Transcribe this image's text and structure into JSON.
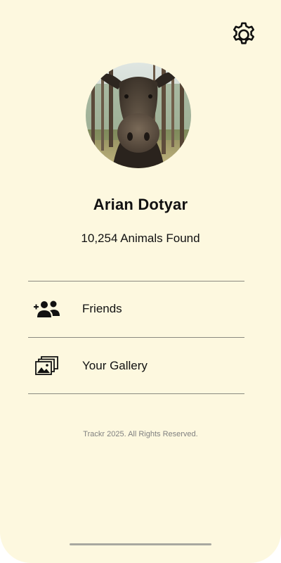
{
  "header": {
    "settings_icon": "gear-icon"
  },
  "profile": {
    "avatar_icon": "moose-photo",
    "name": "Arian Dotyar",
    "animals_found": "10,254 Animals Found"
  },
  "menu": {
    "items": [
      {
        "label": "Friends",
        "icon": "add-friend-icon"
      },
      {
        "label": "Your Gallery",
        "icon": "gallery-icon"
      }
    ]
  },
  "footer": {
    "text": "Trackr 2025. All Rights Reserved."
  },
  "colors": {
    "background": "#fdf8df",
    "text": "#111111",
    "footer_text": "#808080",
    "divider": "#8a8a80"
  }
}
